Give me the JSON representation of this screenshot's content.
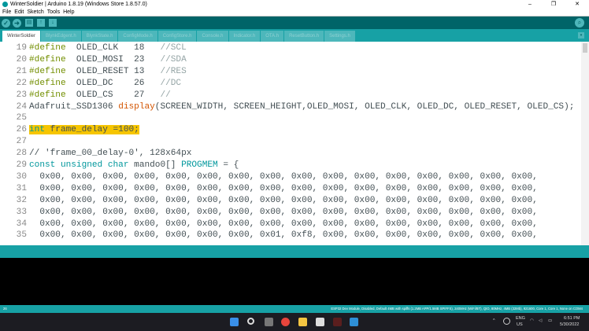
{
  "title": "WinterSoldier | Arduino 1.8.19 (Windows Store 1.8.57.0)",
  "window_controls": [
    "–",
    "❐",
    "✕"
  ],
  "menu": [
    "File",
    "Edit",
    "Sketch",
    "Tools",
    "Help"
  ],
  "toolbar": {
    "verify": "✓",
    "upload": "➜",
    "new": "▤",
    "open": "↑",
    "save": "↓",
    "serial_monitor": "⌕"
  },
  "tabs": [
    "WinterSoldier",
    "BlynkEdgent.h",
    "BlynkState.h",
    "ConfigMode.h",
    "ConfigStore.h",
    "Console.h",
    "Indicator.h",
    "OTA.h",
    "ResetButton.h",
    "Settings.h"
  ],
  "tab_menu": "▾",
  "code": [
    {
      "n": "19",
      "t": [
        [
          "pre",
          "#define"
        ],
        [
          "",
          "  OLED_CLK   18   "
        ],
        [
          "cm",
          "//SCL"
        ]
      ]
    },
    {
      "n": "20",
      "t": [
        [
          "pre",
          "#define"
        ],
        [
          "",
          "  OLED_MOSI  23   "
        ],
        [
          "cm",
          "//SDA"
        ]
      ]
    },
    {
      "n": "21",
      "t": [
        [
          "pre",
          "#define"
        ],
        [
          "",
          "  OLED_RESET 13   "
        ],
        [
          "cm",
          "//RES"
        ]
      ]
    },
    {
      "n": "22",
      "t": [
        [
          "pre",
          "#define"
        ],
        [
          "",
          "  OLED_DC    26   "
        ],
        [
          "cm",
          "//DC"
        ]
      ]
    },
    {
      "n": "23",
      "t": [
        [
          "pre",
          "#define"
        ],
        [
          "",
          "  OLED_CS    27   "
        ],
        [
          "cm",
          "//"
        ]
      ]
    },
    {
      "n": "24",
      "t": [
        [
          "",
          "Adafruit_SSD1306 "
        ],
        [
          "fn",
          "display"
        ],
        [
          "",
          "(SCREEN_WIDTH, SCREEN_HEIGHT,OLED_MOSI, OLED_CLK, OLED_DC, OLED_RESET, OLED_CS);"
        ]
      ]
    },
    {
      "n": "25",
      "t": []
    },
    {
      "n": "26",
      "t": [
        [
          "hltype",
          "int"
        ],
        [
          "hl",
          " frame_delay =100;"
        ]
      ]
    },
    {
      "n": "27",
      "t": []
    },
    {
      "n": "28",
      "t": [
        [
          "",
          "// 'frame_00_delay-0', 128x64px"
        ]
      ]
    },
    {
      "n": "29",
      "t": [
        [
          "type",
          "const unsigned char"
        ],
        [
          "",
          " mando0[] "
        ],
        [
          "type",
          "PROGMEM"
        ],
        [
          "",
          " = {"
        ]
      ]
    },
    {
      "n": "30",
      "t": [
        [
          "",
          "  0x00, 0x00, 0x00, 0x00, 0x00, 0x00, 0x00, 0x00, 0x00, 0x00, 0x00, 0x00, 0x00, 0x00, 0x00, 0x00,"
        ]
      ]
    },
    {
      "n": "31",
      "t": [
        [
          "",
          "  0x00, 0x00, 0x00, 0x00, 0x00, 0x00, 0x00, 0x00, 0x00, 0x00, 0x00, 0x00, 0x00, 0x00, 0x00, 0x00,"
        ]
      ]
    },
    {
      "n": "32",
      "t": [
        [
          "",
          "  0x00, 0x00, 0x00, 0x00, 0x00, 0x00, 0x00, 0x00, 0x00, 0x00, 0x00, 0x00, 0x00, 0x00, 0x00, 0x00,"
        ]
      ]
    },
    {
      "n": "33",
      "t": [
        [
          "",
          "  0x00, 0x00, 0x00, 0x00, 0x00, 0x00, 0x00, 0x00, 0x00, 0x00, 0x00, 0x00, 0x00, 0x00, 0x00, 0x00,"
        ]
      ]
    },
    {
      "n": "34",
      "t": [
        [
          "",
          "  0x00, 0x00, 0x00, 0x00, 0x00, 0x00, 0x00, 0x00, 0x00, 0x00, 0x00, 0x00, 0x00, 0x00, 0x00, 0x00,"
        ]
      ]
    },
    {
      "n": "35",
      "t": [
        [
          "",
          "  0x00, 0x00, 0x00, 0x00, 0x00, 0x00, 0x00, 0x01, 0xf8, 0x00, 0x00, 0x00, 0x00, 0x00, 0x00, 0x00,"
        ]
      ]
    }
  ],
  "status": {
    "line": "26",
    "board": "ESP32 Dev Module, Disabled, Default 4MB with spiffs (1.2MB APP/1.5MB SPIFFS), 240MHz (WiFi/BT), QIO, 80MHz, 4MB (32Mb), 921600, Core 1, Core 1, None on COM4"
  },
  "taskbar": {
    "lang": "ENG",
    "region": "US",
    "time": "6:51 PM",
    "date": "5/30/2022",
    "tray_chevron": "^"
  }
}
